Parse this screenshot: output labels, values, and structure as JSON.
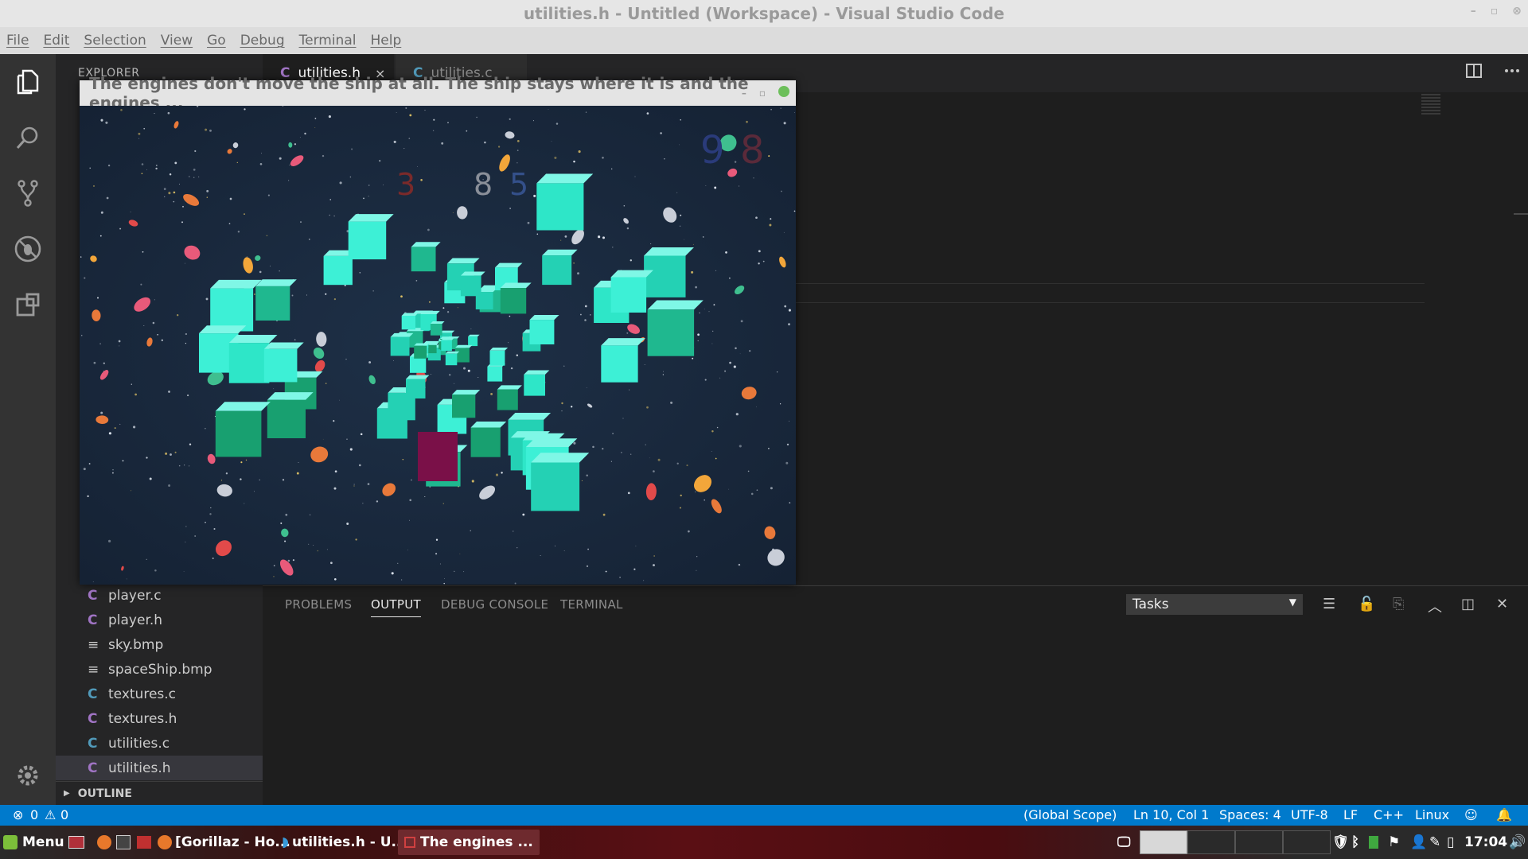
{
  "window": {
    "title": "utilities.h - Untitled (Workspace) - Visual Studio Code",
    "minimize": "–",
    "restore": "▫",
    "close": "⊗"
  },
  "menu": [
    "File",
    "Edit",
    "Selection",
    "View",
    "Go",
    "Debug",
    "Terminal",
    "Help"
  ],
  "activity": [
    "explorer-icon",
    "search-icon",
    "source-control-icon",
    "debug-icon",
    "extensions-icon",
    "gear-icon"
  ],
  "sidebar": {
    "title": "EXPLORER",
    "files": [
      {
        "name": "player.c",
        "type": "C"
      },
      {
        "name": "player.h",
        "type": "C"
      },
      {
        "name": "sky.bmp",
        "type": "≡"
      },
      {
        "name": "spaceShip.bmp",
        "type": "≡"
      },
      {
        "name": "textures.c",
        "type": "C"
      },
      {
        "name": "textures.h",
        "type": "C"
      },
      {
        "name": "utilities.c",
        "type": "C"
      },
      {
        "name": "utilities.h",
        "type": "C"
      }
    ],
    "outline": "OUTLINE"
  },
  "tabs": [
    {
      "label": "utilities.h",
      "icon": "C",
      "close": "×"
    },
    {
      "label": "utilities.c",
      "icon": "C"
    }
  ],
  "panel": {
    "tabs": [
      "PROBLEMS",
      "OUTPUT",
      "DEBUG CONSOLE",
      "TERMINAL"
    ],
    "select_value": "Tasks"
  },
  "status": {
    "errors": "0",
    "warnings": "0",
    "scope": "(Global Scope)",
    "position": "Ln 10, Col 1",
    "spaces": "Spaces: 4",
    "encoding": "UTF-8",
    "eol": "LF",
    "language": "C++",
    "os": "Linux"
  },
  "taskbar": {
    "menu": "Menu",
    "items": [
      "[Gorillaz - Ho...",
      "utilities.h - U...",
      "The engines ..."
    ],
    "time": "17:04"
  },
  "game": {
    "title": "The engines don't move the ship at all. The ship stays where it is and the engines ...",
    "numbers": [
      "3",
      "8",
      "5",
      "9",
      "8"
    ]
  }
}
